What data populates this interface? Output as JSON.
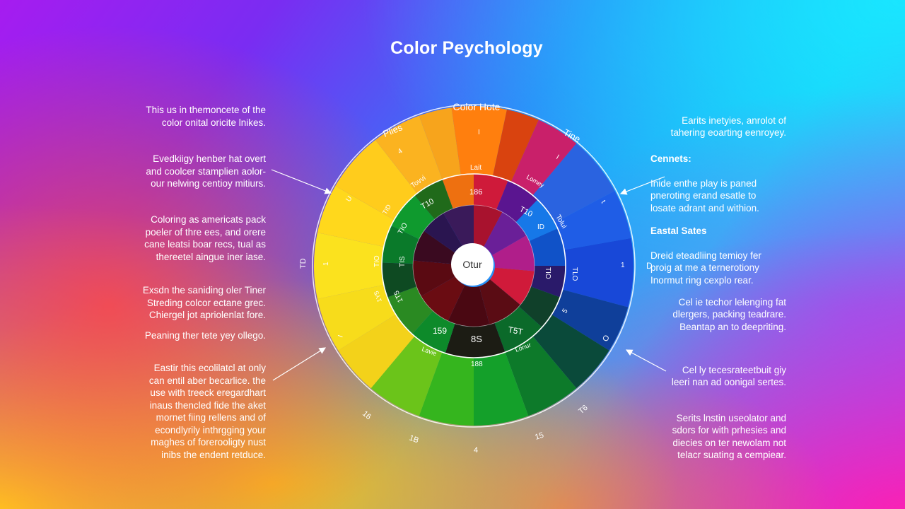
{
  "title": "Color Peychology",
  "wheel": {
    "center_label": "Otur",
    "top_label": "Color Hote",
    "outer_labels": [
      "Plies",
      "Tine",
      "TD",
      "D",
      "16",
      "1B",
      "4",
      "15",
      "T6",
      "O"
    ],
    "ring_labels": [
      "4",
      "I",
      "I",
      "t",
      "U",
      "1",
      "1",
      "5",
      "I"
    ],
    "mid_labels": [
      "Tovvi",
      "Lait",
      "186",
      "Lomey",
      "Tolui",
      "ID",
      "T10",
      "T10",
      "TID",
      "TIO",
      "TIO",
      "TIS",
      "TIO",
      "TLO",
      "1Y5",
      "1T5",
      "159",
      "8S",
      "T5T"
    ],
    "bottom_labels": [
      "188",
      "Lavie",
      "Lonur"
    ]
  },
  "left_paragraphs": [
    {
      "text": "This us in themoncete of the\ncolor onital oricite lnikes."
    },
    {
      "text": "Evedkiigy henber hat overt\nand coolcer stamplien aolor-\nour nelwing centioy mitiurs."
    },
    {
      "text": "Coloring as americats pack\npoeler of thre ees, and orere\ncane leatsi boar recs, tual as\nthereetel aingue iner iase."
    },
    {
      "text": "Exsdn the saniding oler Tiner\nStreding colcor ectane grec.\nChiergel jot apriolenlat fore."
    },
    {
      "text": "Peaning ther tete yey ollego."
    },
    {
      "text": "Eastir this ecolilatcl at only\ncan entil aber becarlice. the\nuse with treeck eregardhart\ninaus thencled fide the aket\nmornet fiing rellens and of\necondlyrily inthrgging your\nmaghes of forerooligty nust\ninibs the endent retduce."
    }
  ],
  "right_paragraphs": [
    {
      "head": "",
      "text": "Earits inetyies, anrolot of\ntahering eoarting eenroyey."
    },
    {
      "head": "Cennets:",
      "text": "Inide enthe play is paned\npneroting erand esatle to\nlosate adrant and withion."
    },
    {
      "head": "Eastal Sates",
      "text": "Dreid eteadliing temioy fer\nproig at me a ternerotiony\nInormut ring cexplo rear."
    },
    {
      "head": "",
      "text": "Cel ie techor lelenging fat\ndlergers, packing teadrare.\nBeantap an to deepriting."
    },
    {
      "head": "",
      "text": "Cel ly tecesrateetbuit giy\nleeri nan ad oonigal sertes."
    },
    {
      "head": "",
      "text": "Serits lnstin useolator and\nsdors for with prhesies and\ndiecies on ter newolam not\ntelacr suating a cempiear."
    }
  ],
  "colors": {
    "text": "#ffffff",
    "wheel_border": "#ffffff",
    "center": "#ffffff"
  }
}
